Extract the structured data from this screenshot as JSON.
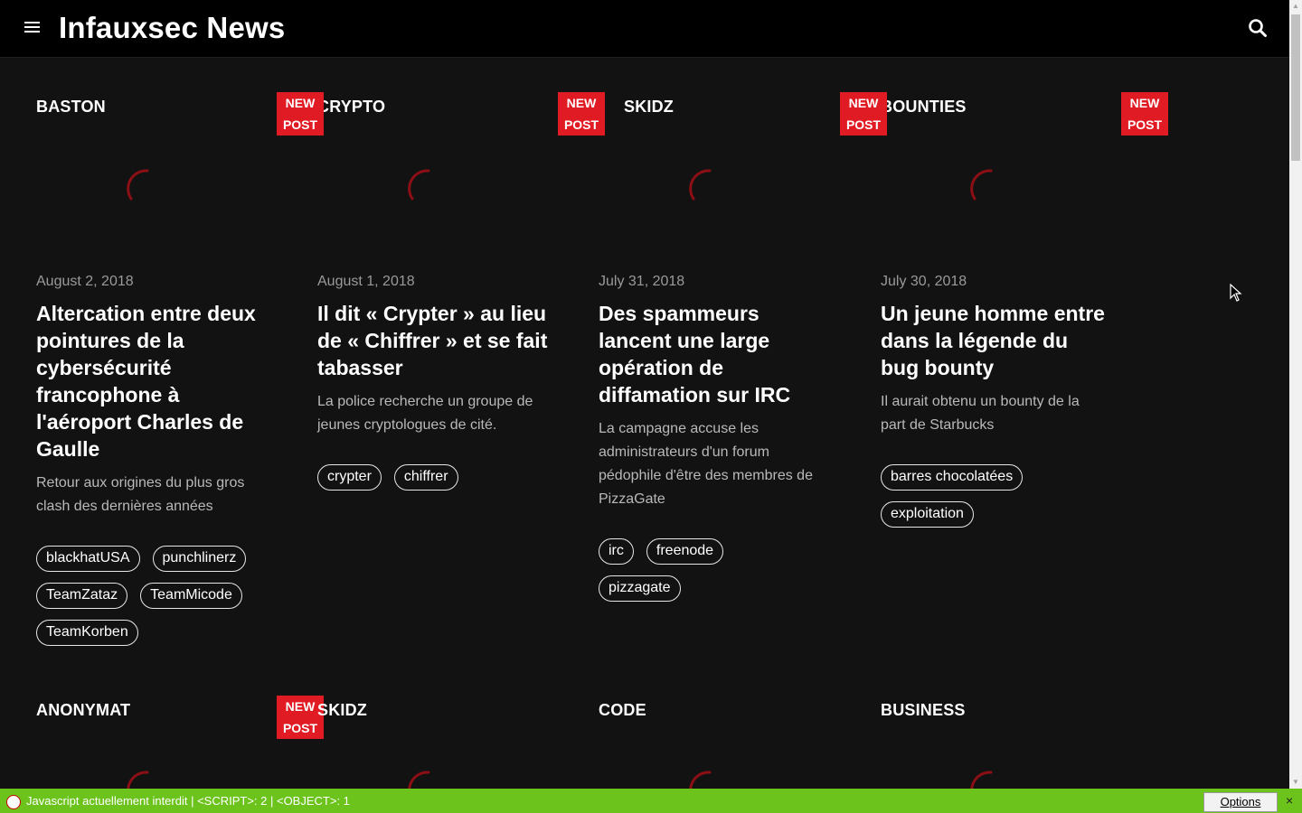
{
  "header": {
    "title": "Infauxsec News"
  },
  "new_badge": {
    "line1": "NEW",
    "line2": "POST"
  },
  "colors": {
    "accent": "#e01b24",
    "background": "#121212",
    "bar": "#6cc31c"
  },
  "articles": [
    {
      "category": "BASTON",
      "date": "August 2, 2018",
      "title": "Altercation entre deux pointures de la cybersécurité francophone à l'aéroport Charles de Gaulle",
      "excerpt": "Retour aux origines du plus gros clash des dernières années",
      "tags": [
        "blackhatUSA",
        "punchlinerz",
        "TeamZataz",
        "TeamMicode",
        "TeamKorben"
      ]
    },
    {
      "category": "CRYPTO",
      "date": "August 1, 2018",
      "title": "Il dit « Crypter » au lieu de « Chiffrer » et se fait tabasser",
      "excerpt": "La police recherche un groupe de jeunes cryptologues de cité.",
      "tags": [
        "crypter",
        "chiffrer"
      ]
    },
    {
      "category": "SKIDZ",
      "date": "July 31, 2018",
      "title": "Des spammeurs lancent une large opération de diffamation sur IRC",
      "excerpt": "La campagne accuse les administrateurs d'un forum pédophile d'être des membres de PizzaGate",
      "tags": [
        "irc",
        "freenode",
        "pizzagate"
      ]
    },
    {
      "category": "BOUNTIES",
      "date": "July 30, 2018",
      "title": "Un jeune homme entre dans la légende du bug bounty",
      "excerpt": "Il aurait obtenu un bounty de la part de Starbucks",
      "tags": [
        "barres chocolatées",
        "exploitation"
      ]
    }
  ],
  "second_row": [
    {
      "category": "ANONYMAT"
    },
    {
      "category": "SKIDZ"
    },
    {
      "category": "CODE"
    },
    {
      "category": "BUSINESS"
    }
  ],
  "noscript": {
    "message": "Javascript actuellement interdit | <SCRIPT>: 2 | <OBJECT>: 1",
    "options_label": "Options",
    "close_label": "×"
  }
}
